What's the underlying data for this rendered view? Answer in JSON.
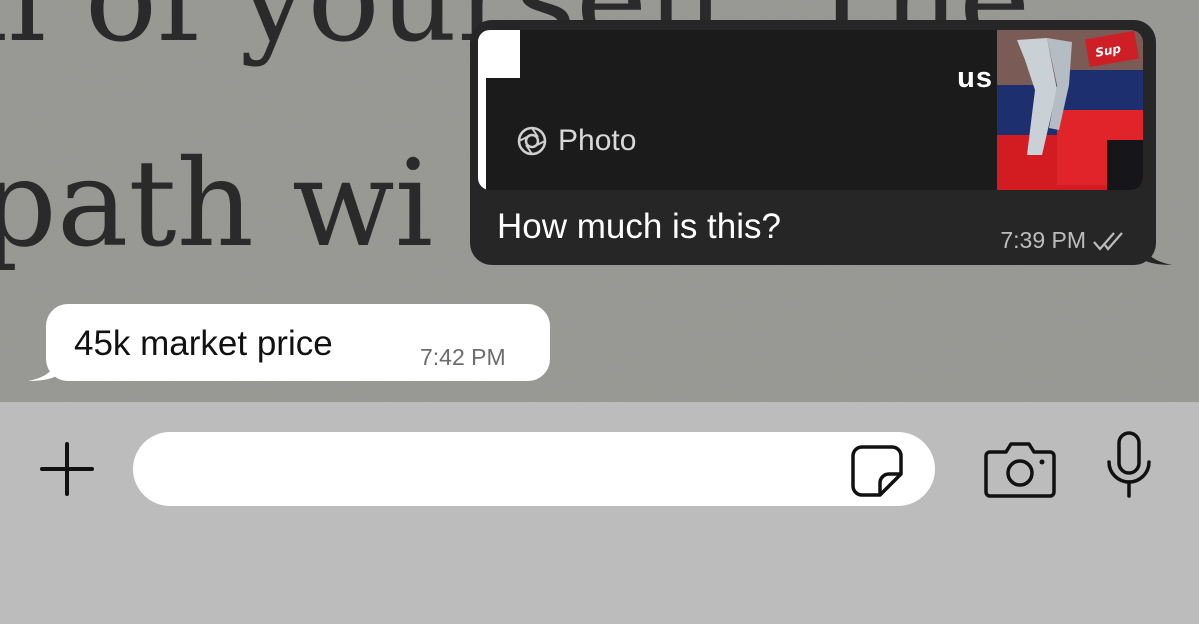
{
  "chat": {
    "messages": [
      {
        "direction": "outgoing",
        "reply_to": {
          "sender": "us",
          "type_label": "Photo",
          "thumbnail_text": "Sup"
        },
        "text": "How much is this?",
        "time": "7:39 PM",
        "status_icon": "double-check-icon"
      },
      {
        "direction": "incoming",
        "text": "45k market price",
        "time": "7:42 PM"
      }
    ]
  },
  "wallpaper": {
    "line1": "ll of yourself. The",
    "line2": "path wi"
  },
  "input_bar": {
    "placeholder": "",
    "value": "",
    "icons": [
      "plus-icon",
      "sticker-icon",
      "camera-icon",
      "microphone-icon"
    ]
  },
  "colors": {
    "outgoing_bubble": "#262626",
    "incoming_bubble": "#ffffff",
    "input_bar": "#bcbcbc"
  }
}
